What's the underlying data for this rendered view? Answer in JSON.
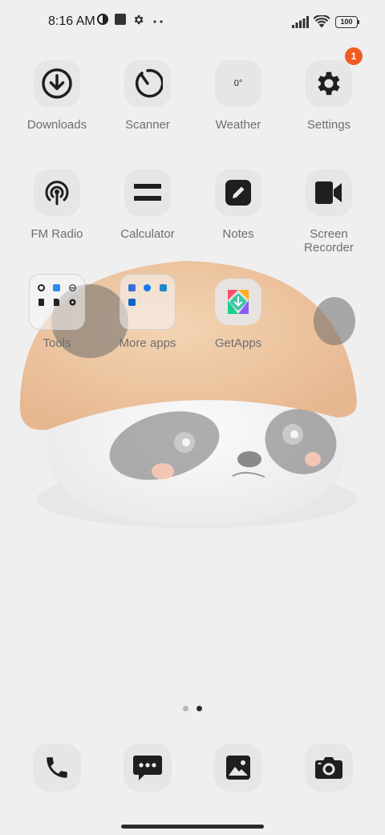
{
  "status_bar": {
    "time": "8:16 AM",
    "battery_level": "100",
    "icons": [
      "data-saver-icon",
      "stop-square-icon",
      "settings-gear-icon",
      "more-dots-icon",
      "signal-bars-icon",
      "wifi-icon",
      "battery-icon"
    ]
  },
  "apps": {
    "downloads": {
      "label": "Downloads",
      "icon": "download-icon"
    },
    "scanner": {
      "label": "Scanner",
      "icon": "scanner-icon"
    },
    "weather": {
      "label": "Weather",
      "temp": "0°"
    },
    "settings": {
      "label": "Settings",
      "icon": "gear-icon",
      "badge": "1"
    },
    "fm_radio": {
      "label": "FM Radio",
      "icon": "radio-tower-icon"
    },
    "calculator": {
      "label": "Calculator",
      "icon": "equals-icon"
    },
    "notes": {
      "label": "Notes",
      "icon": "pencil-icon"
    },
    "screen_recorder": {
      "label": "Screen\nRecorder",
      "icon": "video-camera-icon"
    },
    "tools": {
      "label": "Tools"
    },
    "more_apps": {
      "label": "More apps"
    },
    "getapps": {
      "label": "GetApps",
      "icon": "getapps-icon"
    }
  },
  "page_indicator": {
    "pages": 2,
    "current": 2
  },
  "dock": [
    "phone-icon",
    "messages-icon",
    "gallery-icon",
    "camera-icon"
  ],
  "colors": {
    "background": "#efefef",
    "label": "#6e6e6e",
    "badge": "#f15b22",
    "icon": "#1f1f1f"
  }
}
